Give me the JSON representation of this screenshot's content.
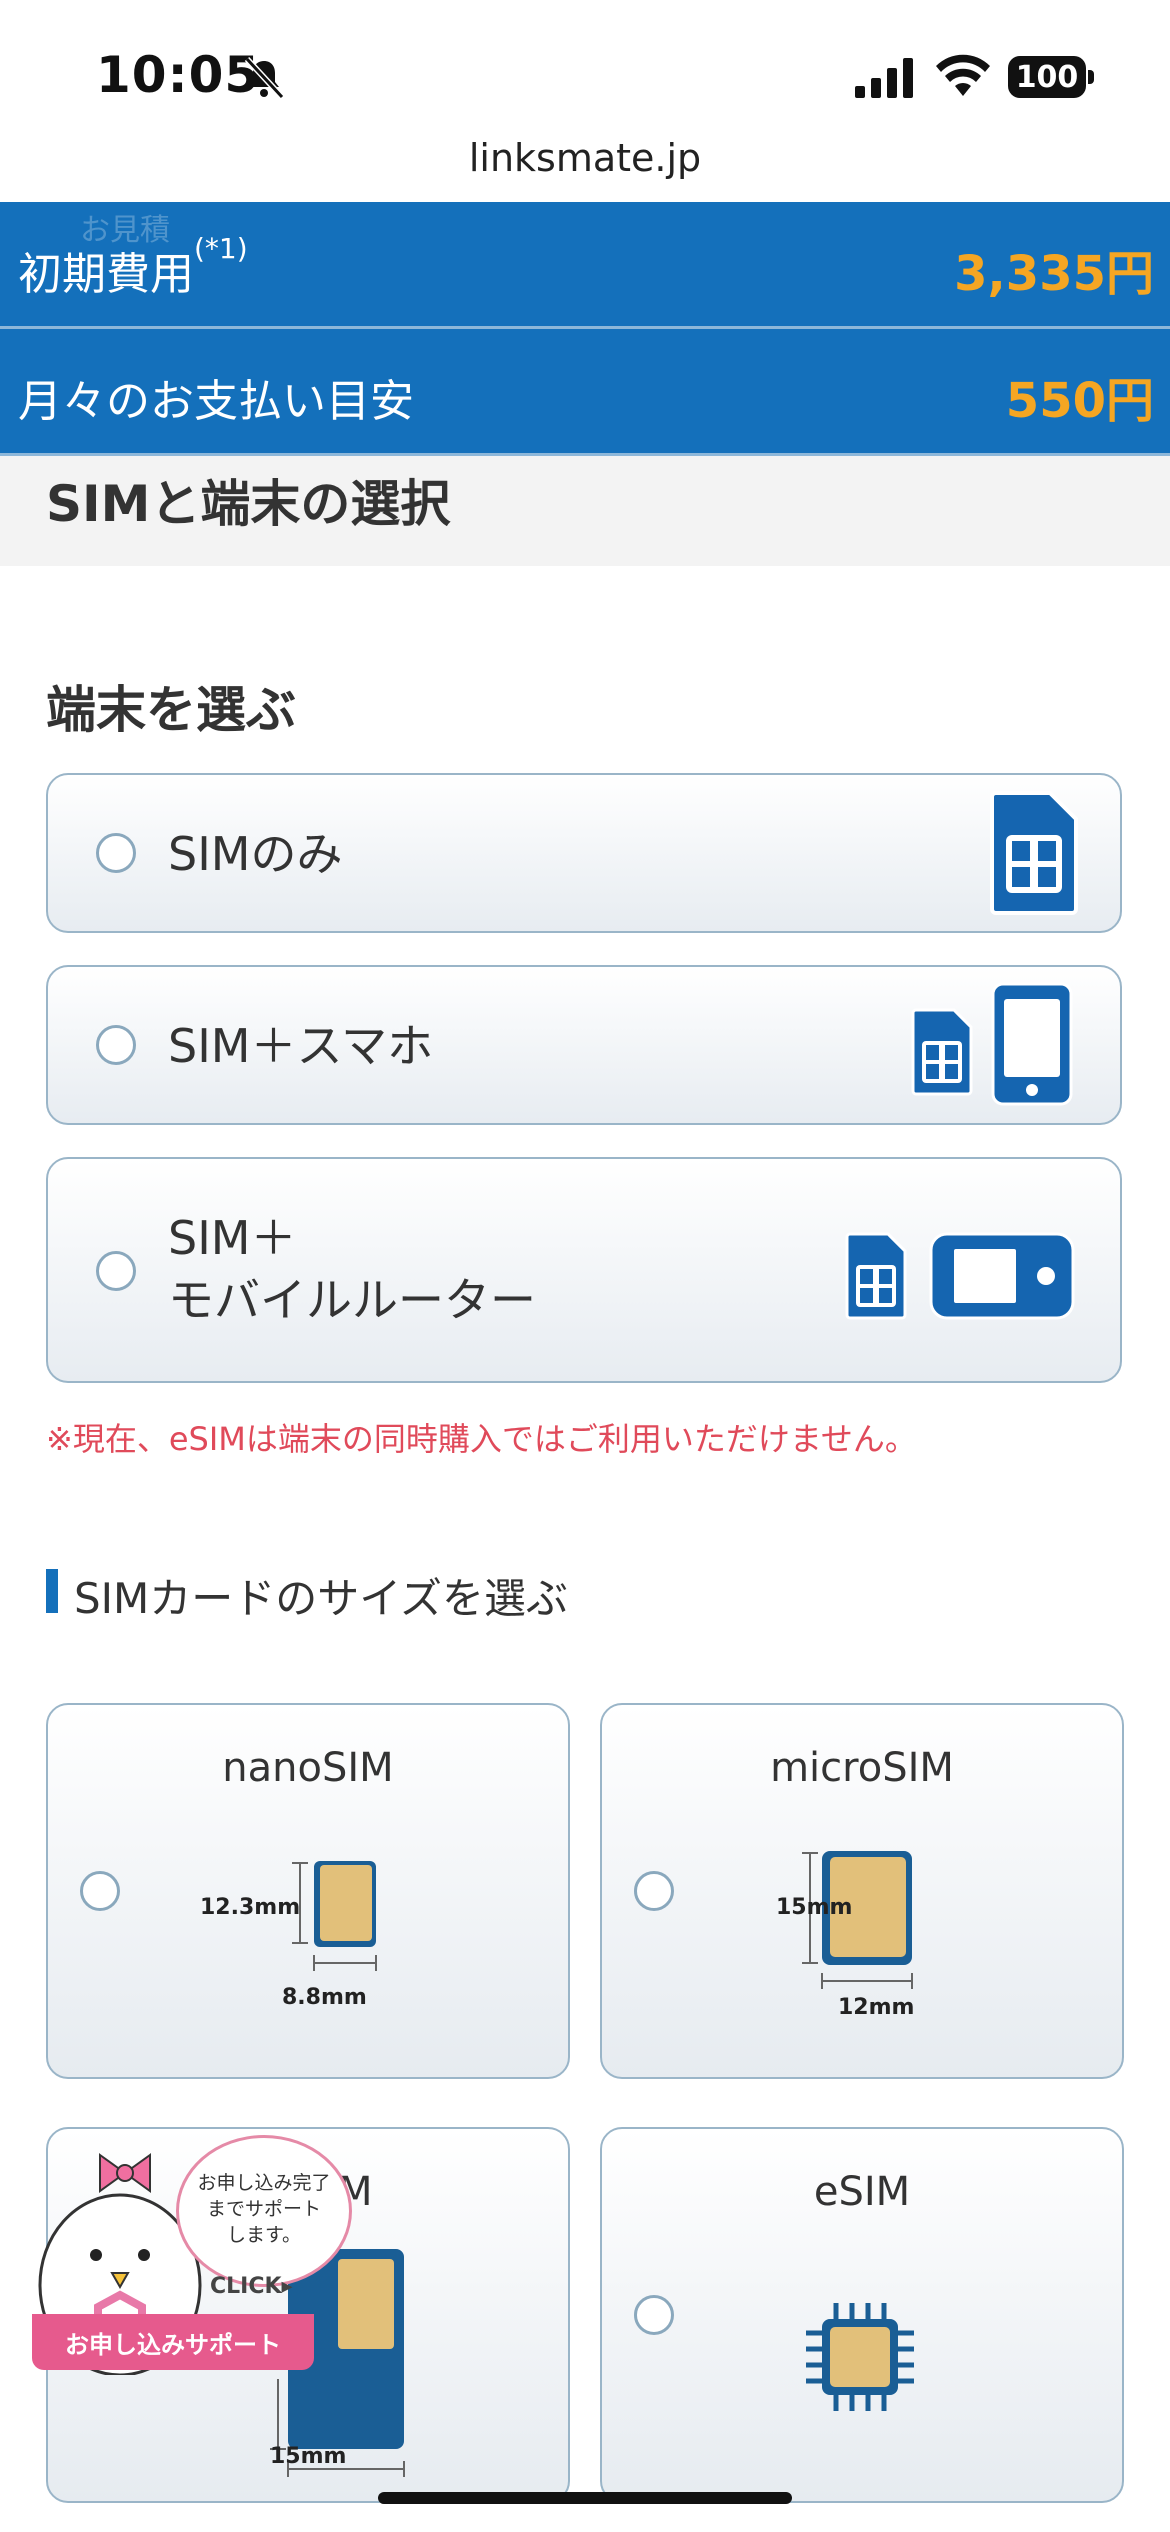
{
  "status_bar": {
    "time": "10:05",
    "battery": "100"
  },
  "browser": {
    "url": "linksmate.jp"
  },
  "price_bar": {
    "ghost_text": "お見積",
    "initial_cost": {
      "label": "初期費用",
      "note": "(*1)",
      "value": "3,335円"
    },
    "monthly": {
      "label": "月々のお支払い目安",
      "value": "550円"
    }
  },
  "section": {
    "title": "SIMと端末の選択"
  },
  "device": {
    "title": "端末を選ぶ",
    "options": [
      {
        "label": "SIMのみ",
        "icon": "sim-card-icon"
      },
      {
        "label": "SIM＋スマホ",
        "icon": "smartphone-icon"
      },
      {
        "label_line1": "SIM＋",
        "label_line2": "モバイルルーター",
        "icon": "mobile-router-icon"
      }
    ],
    "notice": "※現在、eSIMは端末の同時購入ではご利用いただけません。"
  },
  "sim_size": {
    "title": "SIMカードのサイズを選ぶ",
    "cards": [
      {
        "name": "nanoSIM",
        "height": "12.3mm",
        "width": "8.8mm"
      },
      {
        "name": "microSIM",
        "height": "15mm",
        "width": "12mm"
      },
      {
        "name_visible": "M",
        "width": "15mm"
      },
      {
        "name": "eSIM"
      }
    ]
  },
  "support": {
    "bubble_line1": "お申し込み完了",
    "bubble_line2": "までサポート",
    "bubble_line3": "します。",
    "click": "CLICK",
    "band": "お申し込みサポート"
  },
  "colors": {
    "primary": "#1470bb",
    "price": "#f5a623",
    "notice": "#e04a5a",
    "support": "#e65a8d"
  }
}
